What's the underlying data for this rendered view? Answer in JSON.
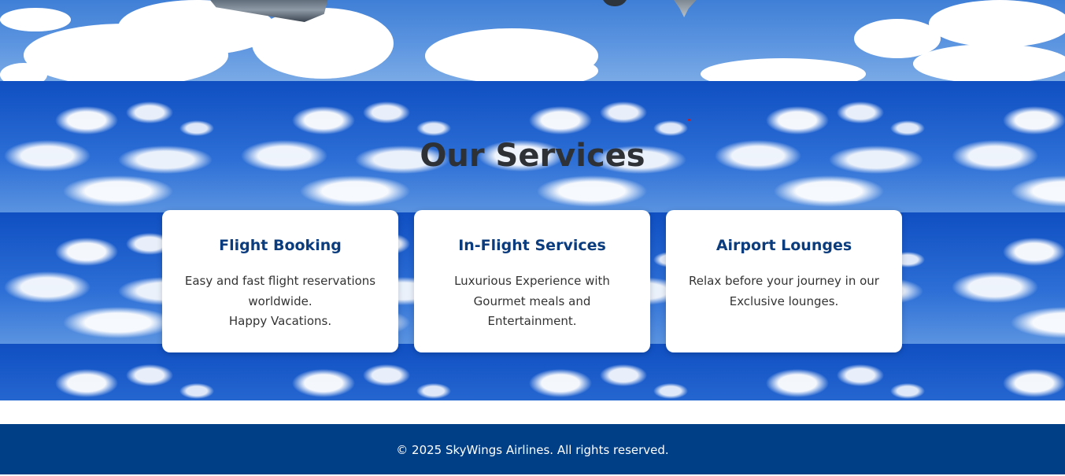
{
  "hero": {
    "image": "sky-with-clouds-and-airplane"
  },
  "services": {
    "title": "Our Services",
    "cards": [
      {
        "title": "Flight Booking",
        "lines": [
          "Easy and fast flight reservations",
          "worldwide.",
          "Happy Vacations."
        ]
      },
      {
        "title": "In-Flight Services",
        "lines": [
          "Luxurious Experience with",
          "Gourmet meals and",
          "Entertainment."
        ]
      },
      {
        "title": "Airport Lounges",
        "lines": [
          "Relax before your journey in our",
          "Exclusive lounges."
        ]
      }
    ]
  },
  "footer": {
    "copyright": "© 2025 SkyWings Airlines. All rights reserved."
  },
  "colors": {
    "footer_bg": "#003f86",
    "card_title": "#0b3d7e",
    "section_title": "#2e3135"
  }
}
